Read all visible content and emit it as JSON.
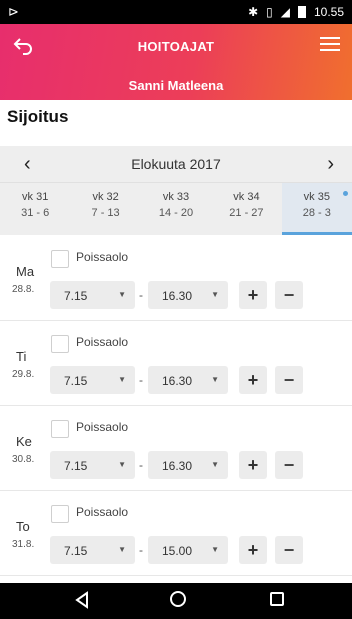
{
  "status_bar": {
    "left_glyph": "⊳",
    "icons": [
      "bluetooth-icon",
      "vibrate-icon",
      "signal-icon",
      "battery-icon"
    ],
    "time": "10.55"
  },
  "header": {
    "title": "HOITOAJAT",
    "subtitle": "Sanni Matleena",
    "gradient_colors": [
      "#e72e6d",
      "#f06f2e"
    ]
  },
  "section": {
    "title": "Sijoitus"
  },
  "month_nav": {
    "prev": "‹",
    "month": "Elokuuta 2017",
    "next": "›"
  },
  "weeks": [
    {
      "label": "vk 31",
      "range": "31 - 6"
    },
    {
      "label": "vk 32",
      "range": "7 - 13"
    },
    {
      "label": "vk 33",
      "range": "14 - 20"
    },
    {
      "label": "vk 34",
      "range": "21 - 27"
    },
    {
      "label": "vk 35",
      "range": "28 - 3",
      "active": true
    }
  ],
  "days": [
    {
      "name": "Ma",
      "date": "28.8.",
      "absence_label": "Poissaolo",
      "start": "7.15",
      "end": "16.30",
      "plus": "+",
      "minus": "−"
    },
    {
      "name": "Ti",
      "date": "29.8.",
      "absence_label": "Poissaolo",
      "start": "7.15",
      "end": "16.30",
      "plus": "+",
      "minus": "−"
    },
    {
      "name": "Ke",
      "date": "30.8.",
      "absence_label": "Poissaolo",
      "start": "7.15",
      "end": "16.30",
      "plus": "+",
      "minus": "−"
    },
    {
      "name": "To",
      "date": "31.8.",
      "absence_label": "Poissaolo",
      "start": "7.15",
      "end": "15.00",
      "plus": "+",
      "minus": "−"
    }
  ],
  "separator": "-",
  "accent_color": "#5aa3dc"
}
